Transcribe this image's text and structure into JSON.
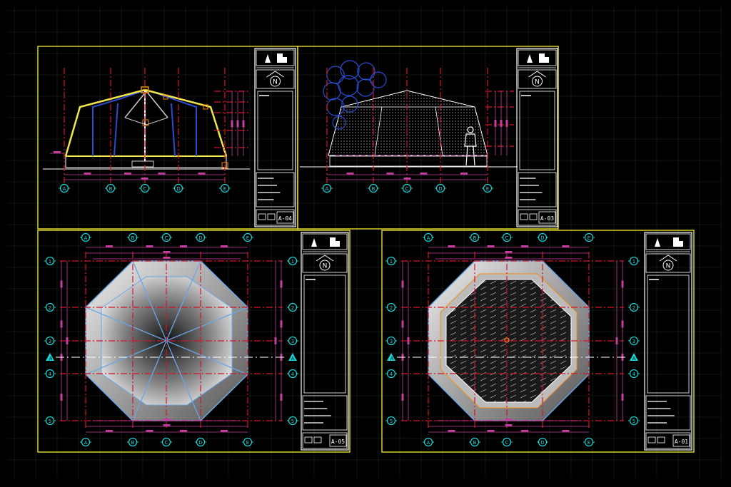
{
  "sheets": [
    {
      "id": "elev-section",
      "code": "A-04",
      "view": "section"
    },
    {
      "id": "elev-front",
      "code": "A-03",
      "view": "elevation"
    },
    {
      "id": "plan-roof",
      "code": "A-05",
      "view": "roof"
    },
    {
      "id": "plan-floor",
      "code": "A-01",
      "view": "floor"
    }
  ],
  "axes_letters": [
    "A",
    "B",
    "C",
    "D",
    "E"
  ],
  "axes_numbers": [
    "1",
    "2",
    "3",
    "4",
    "5"
  ],
  "north_label": "N",
  "section_marks": [
    "A",
    "A'"
  ],
  "colors": {
    "background": "#000000",
    "grid": "#1e2a1e",
    "frame": "#d7d02a",
    "axis_red": "#d1162a",
    "bubble": "#19d6d6",
    "dim_magenta": "#c43fa0",
    "white": "#ffffff",
    "blue": "#2b4bd1",
    "yellow_line": "#f1e64a",
    "orange": "#f08a12",
    "light_blue": "#6aa6e6"
  }
}
